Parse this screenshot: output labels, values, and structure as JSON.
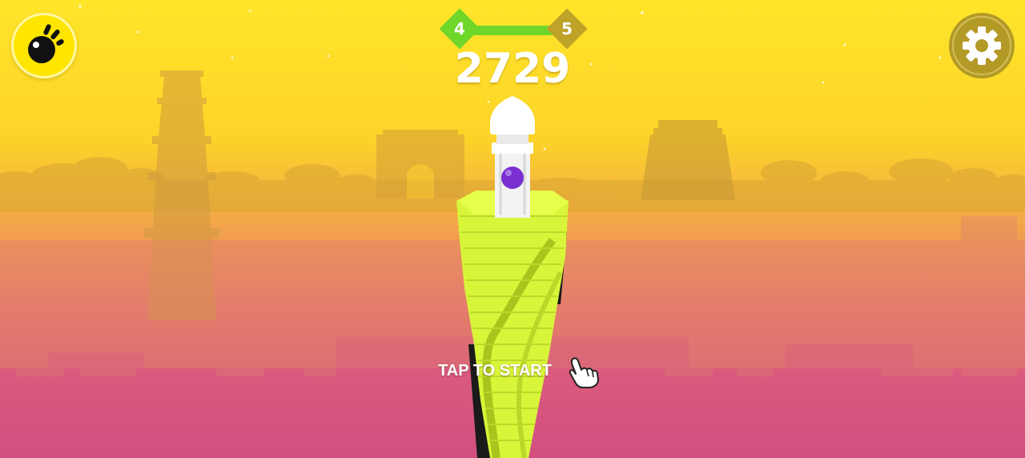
{
  "hud": {
    "level_current": "4",
    "level_next": "5",
    "level_progress": 1.0,
    "score": "2729"
  },
  "prompt": {
    "tap_to_start": "TAP TO START"
  },
  "icons": {
    "bonus": "ball-bonus-icon",
    "settings": "gear-icon",
    "hand": "tap-hand-icon"
  },
  "colors": {
    "sky_top": "#ffe52a",
    "sky_bottom": "#cf4a82",
    "tower_platform": "#d8f53a",
    "tower_hazard": "#1a1a1a",
    "ball": "#7a2fd0",
    "progress_done": "#6fd62a",
    "progress_remaining": "#bfa328",
    "settings_bg": "#b39a26",
    "bonus_bg": "#ffe600"
  }
}
